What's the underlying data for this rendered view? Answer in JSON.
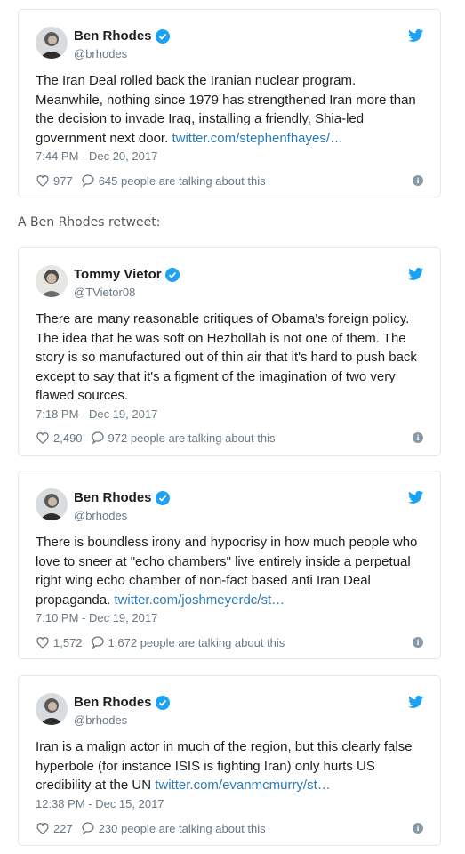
{
  "caption": "A Ben Rhodes retweet:",
  "colors": {
    "link": "#2b7bb9",
    "verified": "#1da1f2",
    "bird": "#1da1f2",
    "meta": "#697882"
  },
  "tweets": [
    {
      "name": "Ben Rhodes",
      "handle": "@brhodes",
      "text": "The Iran Deal rolled back the Iranian nuclear program. Meanwhile, nothing since 1979 has strengthened Iran more than the decision to invade Iraq, installing a friendly, Shia-led government next door.",
      "link": "twitter.com/stephenfhayes/…",
      "time": "7:44 PM - Dec 20, 2017",
      "likes": "977",
      "talking": "645 people are talking about this"
    },
    {
      "name": "Tommy Vietor",
      "handle": "@TVietor08",
      "text": "There are many reasonable critiques of Obama's foreign policy. The idea that he was soft on Hezbollah is not one of them. The story is so manufactured out of thin air that it's hard to push back except to say that it's a figment of the imagination of two very flawed sources.",
      "link": "",
      "time": "7:18 PM - Dec 19, 2017",
      "likes": "2,490",
      "talking": "972 people are talking about this"
    },
    {
      "name": "Ben Rhodes",
      "handle": "@brhodes",
      "text": "There is boundless irony and hypocrisy in how much people who love to sneer at \"echo chambers\" live entirely inside a perpetual right wing echo chamber of non-fact based anti Iran Deal propaganda.",
      "link": "twitter.com/joshmeyerdc/st…",
      "time": "7:10 PM - Dec 19, 2017",
      "likes": "1,572",
      "talking": "1,672 people are talking about this"
    },
    {
      "name": "Ben Rhodes",
      "handle": "@brhodes",
      "text": "Iran is a malign actor in much of the region, but this clearly false hyperbole (for instance ISIS is fighting Iran) only hurts US credibility at the UN",
      "link": "twitter.com/evanmcmurry/st…",
      "time": "12:38 PM - Dec 15, 2017",
      "likes": "227",
      "talking": "230 people are talking about this"
    }
  ]
}
